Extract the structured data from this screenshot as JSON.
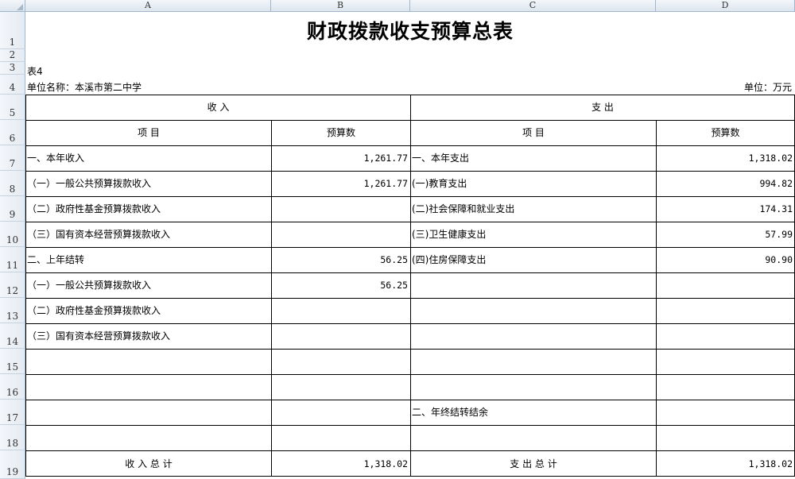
{
  "columns": [
    "A",
    "B",
    "C",
    "D"
  ],
  "rows": [
    "1",
    "2",
    "3",
    "4",
    "5",
    "6",
    "7",
    "8",
    "9",
    "10",
    "11",
    "12",
    "13",
    "14",
    "15",
    "16",
    "17",
    "18",
    "19"
  ],
  "title": "财政拨款收支预算总表",
  "table_no": "表4",
  "unit_name": "单位名称：本溪市第二中学",
  "unit": "单位：万元",
  "headers": {
    "income": "收    入",
    "expense": "支    出",
    "item_left": "项    目",
    "budget_left": "预算数",
    "item_right": "项    目",
    "budget_right": "预算数"
  },
  "body": [
    {
      "a": "一、本年收入",
      "b": "1,261.77",
      "c": "一、本年支出",
      "d": "1,318.02"
    },
    {
      "a": "（一）一般公共预算拨款收入",
      "b": "1,261.77",
      "c": "(一)教育支出",
      "d": "994.82"
    },
    {
      "a": "（二）政府性基金预算拨款收入",
      "b": "",
      "c": "(二)社会保障和就业支出",
      "d": "174.31"
    },
    {
      "a": "（三）国有资本经营预算拨款收入",
      "b": "",
      "c": "(三)卫生健康支出",
      "d": "57.99"
    },
    {
      "a": "二、上年结转",
      "b": "56.25",
      "c": "(四)住房保障支出",
      "d": "90.90"
    },
    {
      "a": "（一）一般公共预算拨款收入",
      "b": "56.25",
      "c": "",
      "d": ""
    },
    {
      "a": "（二）政府性基金预算拨款收入",
      "b": "",
      "c": "",
      "d": ""
    },
    {
      "a": "（三）国有资本经营预算拨款收入",
      "b": "",
      "c": "",
      "d": ""
    },
    {
      "a": "",
      "b": "",
      "c": "",
      "d": ""
    },
    {
      "a": "",
      "b": "",
      "c": "",
      "d": ""
    },
    {
      "a": "",
      "b": "",
      "c": "二、年终结转结余",
      "d": ""
    },
    {
      "a": "",
      "b": "",
      "c": "",
      "d": ""
    }
  ],
  "totals": {
    "income_label": "收    入    总    计",
    "income_value": "1,318.02",
    "expense_label": "支    出    总    计",
    "expense_value": "1,318.02"
  }
}
